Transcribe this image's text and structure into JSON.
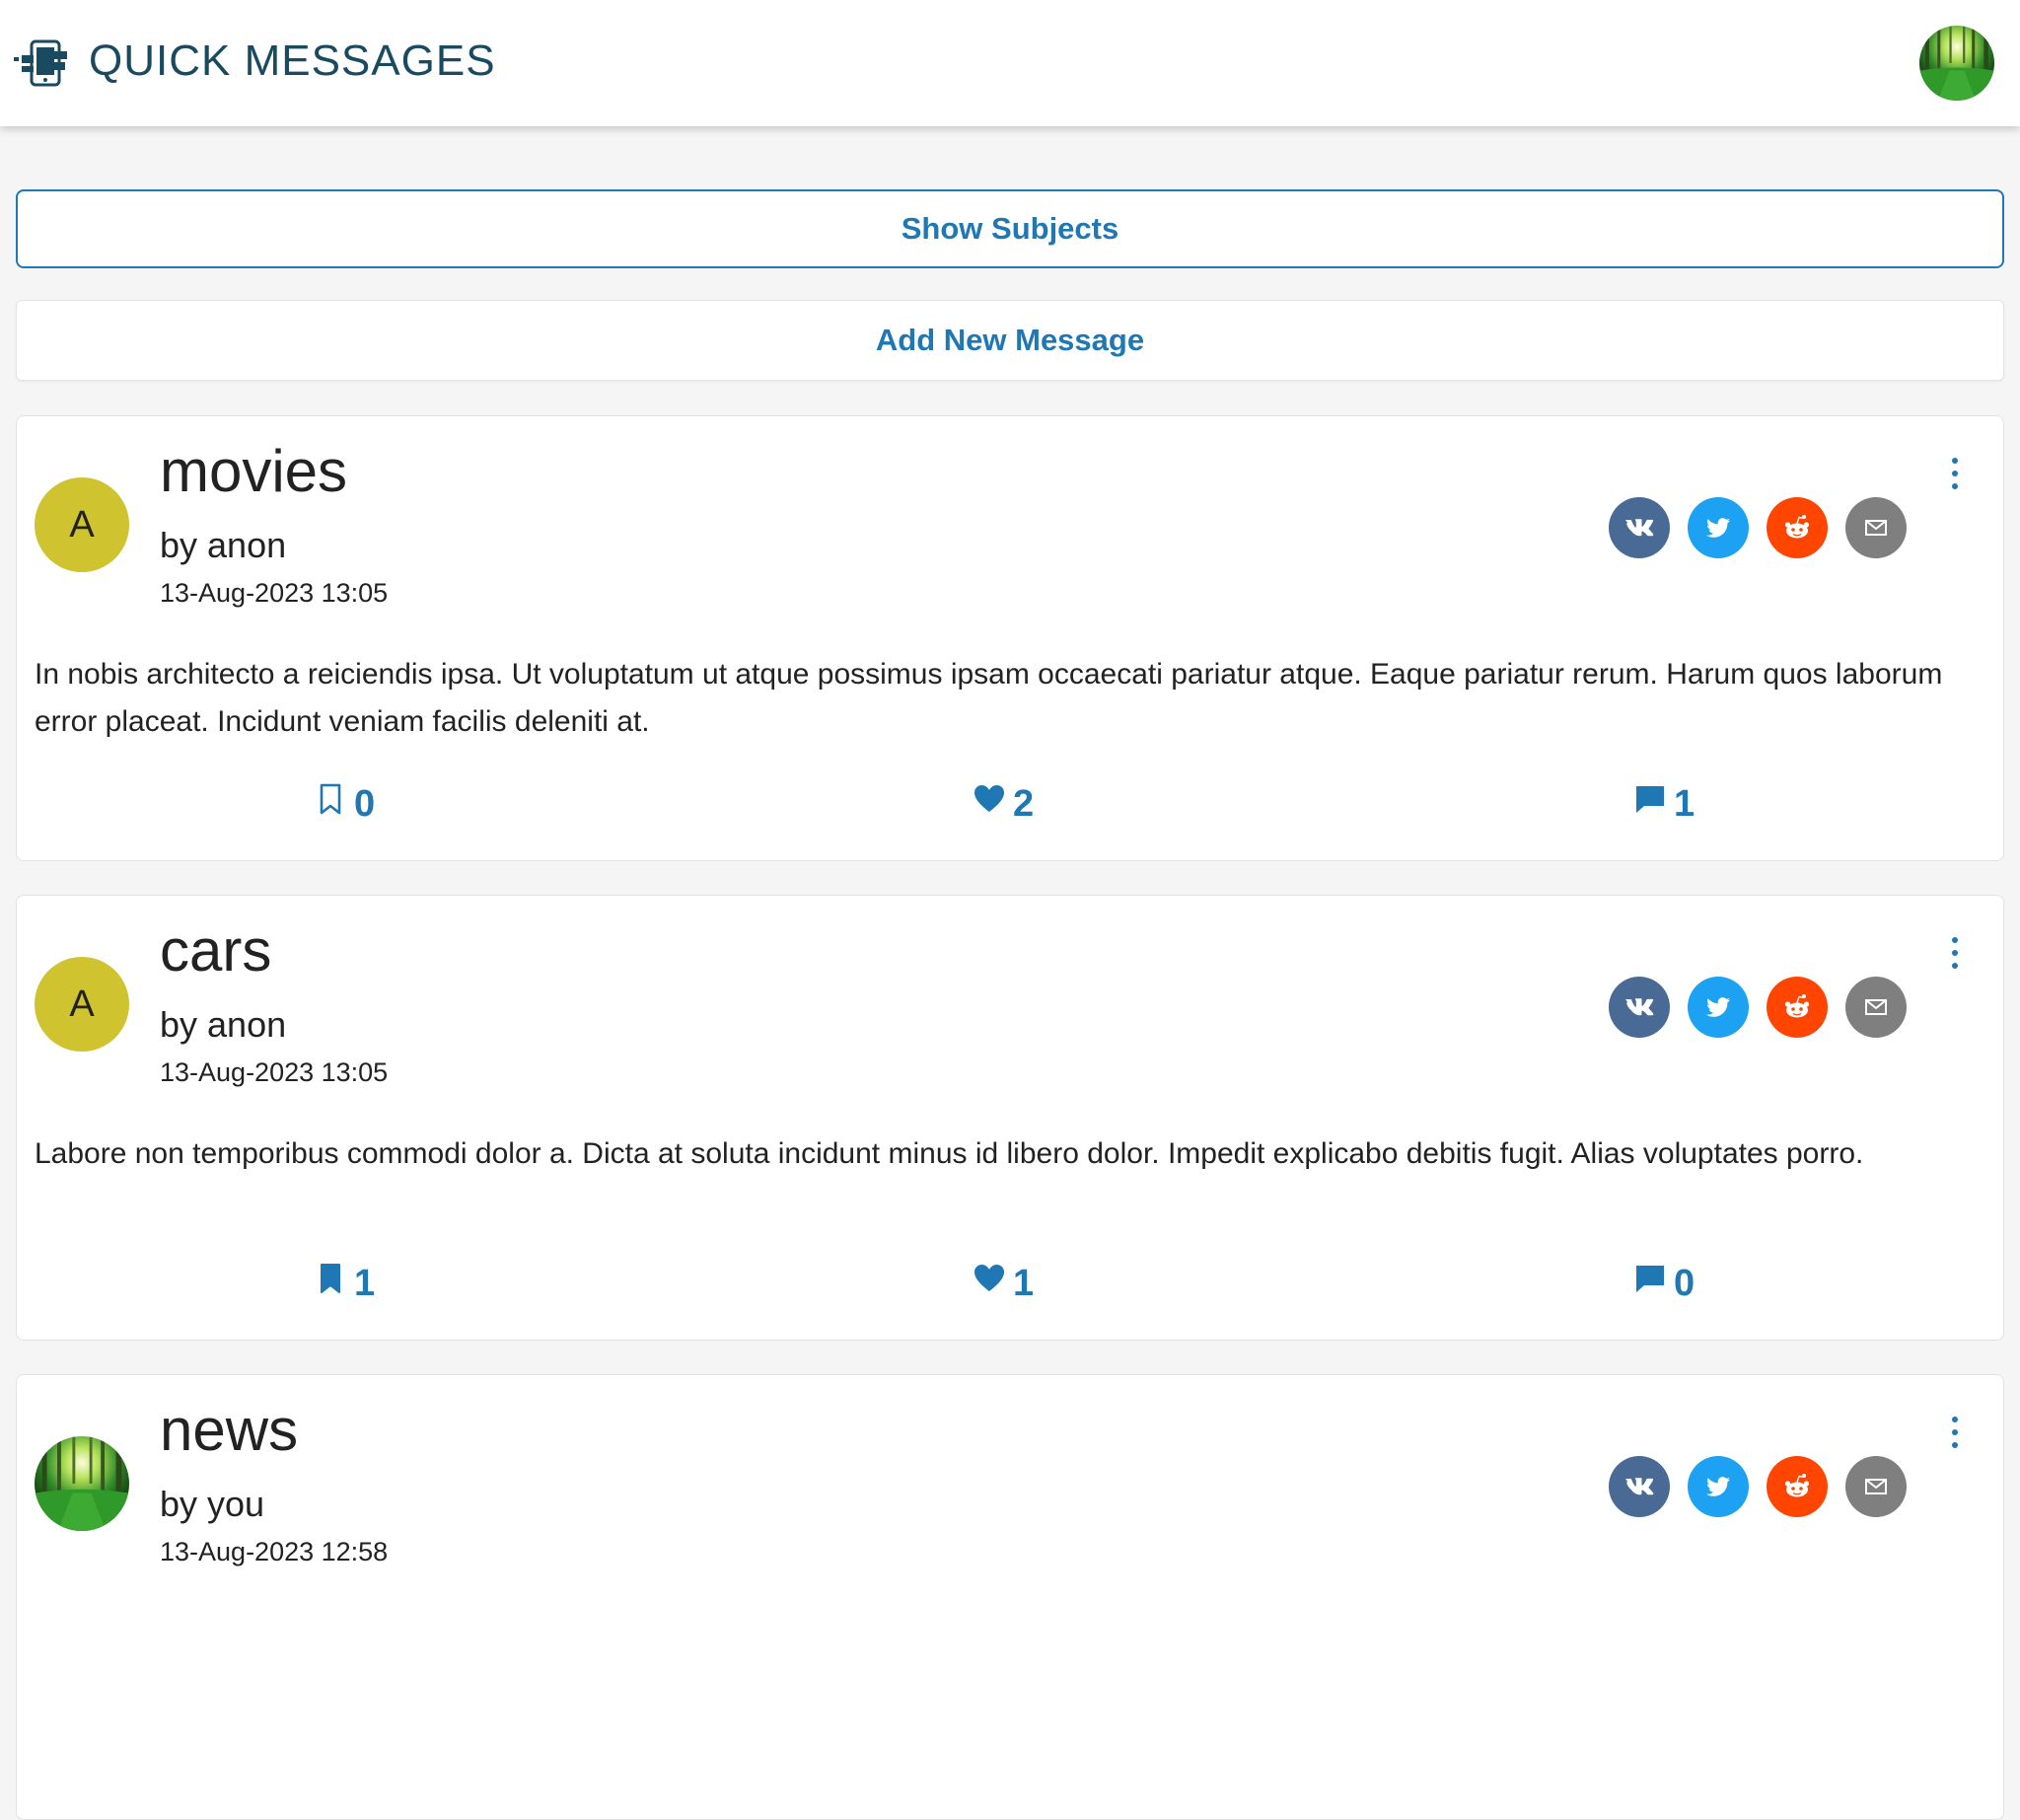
{
  "header": {
    "title": "QUICK MESSAGES",
    "logo_icon": "devices-icon",
    "avatar_icon": "forest-photo"
  },
  "actions": {
    "show_subjects": "Show Subjects",
    "add_message": "Add New Message"
  },
  "colors": {
    "accent": "#1f77b4",
    "avatar_letter_bg": "#cfc330",
    "vk": "#4a6a96",
    "twitter": "#1da1f2",
    "reddit": "#ff4500",
    "email": "#7f7f7f"
  },
  "share_icons": [
    "vk-icon",
    "twitter-icon",
    "reddit-icon",
    "email-icon"
  ],
  "messages": [
    {
      "subject": "movies",
      "author": "by anon",
      "date": "13-Aug-2023 13:05",
      "avatar_letter": "A",
      "body": "In nobis architecto a reiciendis ipsa. Ut voluptatum ut atque possimus ipsam occaecati pariatur atque. Eaque pariatur rerum. Harum quos laborum error placeat. Incidunt veniam facilis deleniti at.",
      "bookmarks": "0",
      "bookmarked": false,
      "likes": "2",
      "comments": "1"
    },
    {
      "subject": "cars",
      "author": "by anon",
      "date": "13-Aug-2023 13:05",
      "avatar_letter": "A",
      "body": "Labore non temporibus commodi dolor a. Dicta at soluta incidunt minus id libero dolor. Impedit explicabo debitis fugit. Alias voluptates porro.",
      "bookmarks": "1",
      "bookmarked": true,
      "likes": "1",
      "comments": "0"
    },
    {
      "subject": "news",
      "author": "by you",
      "date": "13-Aug-2023 12:58",
      "avatar_letter": "",
      "body": "",
      "bookmarks": "",
      "bookmarked": false,
      "likes": "",
      "comments": ""
    }
  ]
}
